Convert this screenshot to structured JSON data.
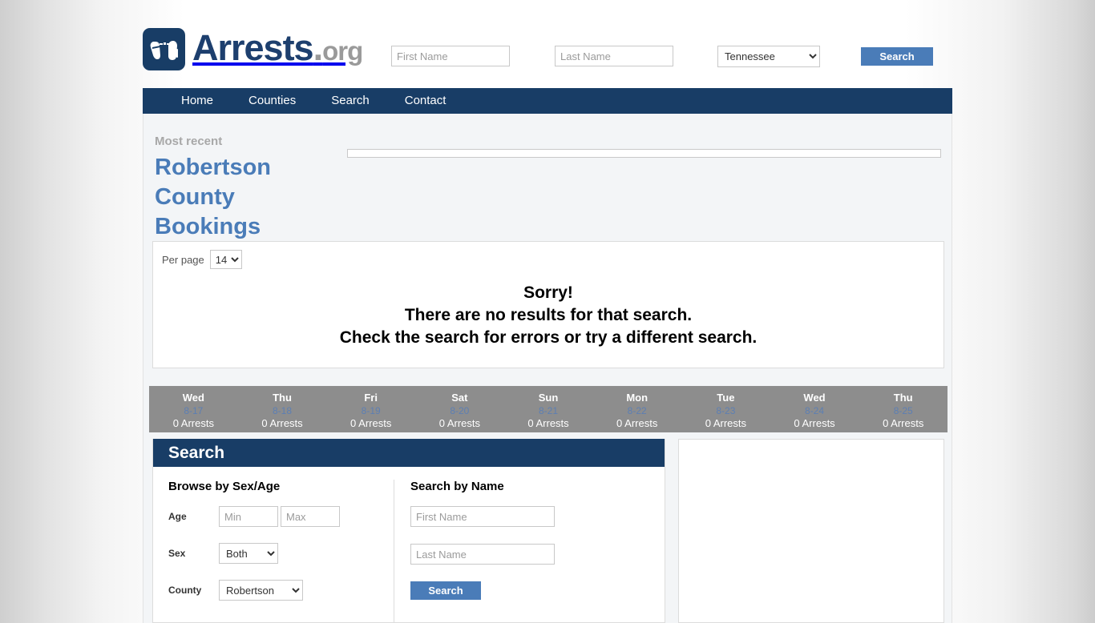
{
  "site": {
    "brand_name": "Arrests",
    "brand_dot": ".",
    "brand_tld": "org",
    "logo_icon": "handcuffs-icon",
    "accent_blue": "#4a7cb8",
    "navy": "#183d66",
    "link_blue": "#5d7fb3",
    "strip_gray": "#8d8d8d"
  },
  "header": {
    "first_name_placeholder": "First Name",
    "first_name_value": "",
    "last_name_placeholder": "Last Name",
    "last_name_value": "",
    "state_selected": "Tennessee",
    "state_options": [
      "Tennessee"
    ],
    "search_label": "Search"
  },
  "nav": {
    "items": [
      {
        "label": "Home"
      },
      {
        "label": "Counties"
      },
      {
        "label": "Search"
      },
      {
        "label": "Contact"
      }
    ]
  },
  "recent": {
    "kicker": "Most recent",
    "title": "Robertson County Bookings"
  },
  "results": {
    "per_page_label": "Per page",
    "per_page_value": "14",
    "per_page_options": [
      "14"
    ],
    "message_line1": "Sorry!",
    "message_line2": "There are no results for that search.",
    "message_line3": "Check the search for errors or try a different search."
  },
  "days": [
    {
      "dow": "Wed",
      "date": "8-17",
      "count": "0 Arrests"
    },
    {
      "dow": "Thu",
      "date": "8-18",
      "count": "0 Arrests"
    },
    {
      "dow": "Fri",
      "date": "8-19",
      "count": "0 Arrests"
    },
    {
      "dow": "Sat",
      "date": "8-20",
      "count": "0 Arrests"
    },
    {
      "dow": "Sun",
      "date": "8-21",
      "count": "0 Arrests"
    },
    {
      "dow": "Mon",
      "date": "8-22",
      "count": "0 Arrests"
    },
    {
      "dow": "Tue",
      "date": "8-23",
      "count": "0 Arrests"
    },
    {
      "dow": "Wed",
      "date": "8-24",
      "count": "0 Arrests"
    },
    {
      "dow": "Thu",
      "date": "8-25",
      "count": "0 Arrests"
    }
  ],
  "search_panel": {
    "title": "Search",
    "browse_title": "Browse by Sex/Age",
    "age_label": "Age",
    "age_min_placeholder": "Min",
    "age_min_value": "",
    "age_max_placeholder": "Max",
    "age_max_value": "",
    "sex_label": "Sex",
    "sex_selected": "Both",
    "sex_options": [
      "Both"
    ],
    "county_label": "County",
    "county_selected": "Robertson",
    "county_options": [
      "Robertson"
    ],
    "name_title": "Search by Name",
    "first_name_placeholder": "First Name",
    "first_name_value": "",
    "last_name_placeholder": "Last Name",
    "last_name_value": "",
    "submit_label": "Search"
  }
}
